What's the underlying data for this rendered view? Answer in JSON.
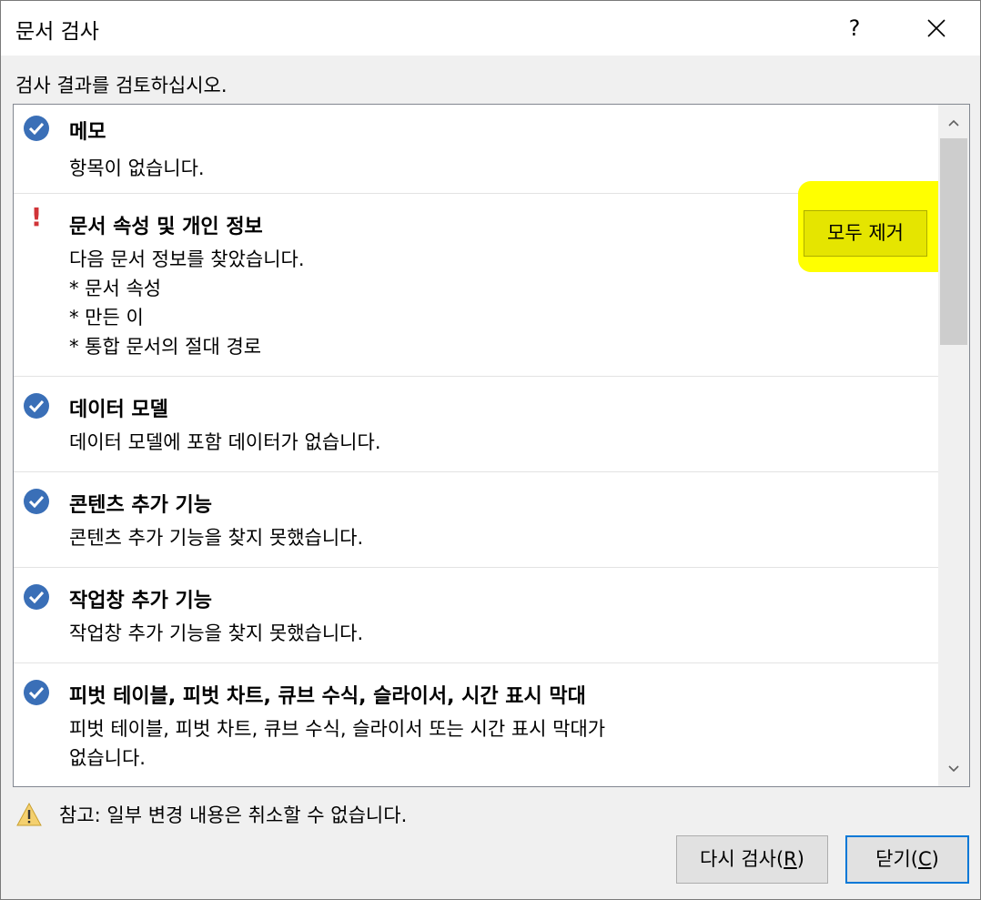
{
  "window": {
    "title": "문서 검사",
    "help_label": "?"
  },
  "subtitle": "검사 결과를 검토하십시오.",
  "items": [
    {
      "status": "ok",
      "title": "메모",
      "description": "항목이 없습니다."
    },
    {
      "status": "warning",
      "title": "문서 속성 및 개인 정보",
      "description": "다음 문서 정보를 찾았습니다.\n* 문서 속성\n* 만든 이\n* 통합 문서의 절대 경로",
      "action_label": "모두 제거"
    },
    {
      "status": "ok",
      "title": "데이터 모델",
      "description": "데이터 모델에 포함 데이터가 없습니다."
    },
    {
      "status": "ok",
      "title": "콘텐츠 추가 기능",
      "description": "콘텐츠 추가 기능을 찾지 못했습니다."
    },
    {
      "status": "ok",
      "title": "작업창 추가 기능",
      "description": "작업창 추가 기능을 찾지 못했습니다."
    },
    {
      "status": "ok",
      "title": "피벗 테이블, 피벗 차트, 큐브 수식, 슬라이서, 시간 표시 막대",
      "description": "피벗 테이블, 피벗 차트, 큐브 수식, 슬라이서 또는 시간 표시 막대가\n없습니다."
    }
  ],
  "note": "참고: 일부 변경 내용은 취소할 수 없습니다.",
  "buttons": {
    "reinspect": {
      "text": "다시 검사(",
      "key": "R",
      "end": ")"
    },
    "close": {
      "text": "닫기(",
      "key": "C",
      "end": ")"
    }
  },
  "colors": {
    "accent": "#0078d7",
    "check": "#3a6fb7",
    "warning": "#d13438",
    "highlight": "#ffff00"
  }
}
